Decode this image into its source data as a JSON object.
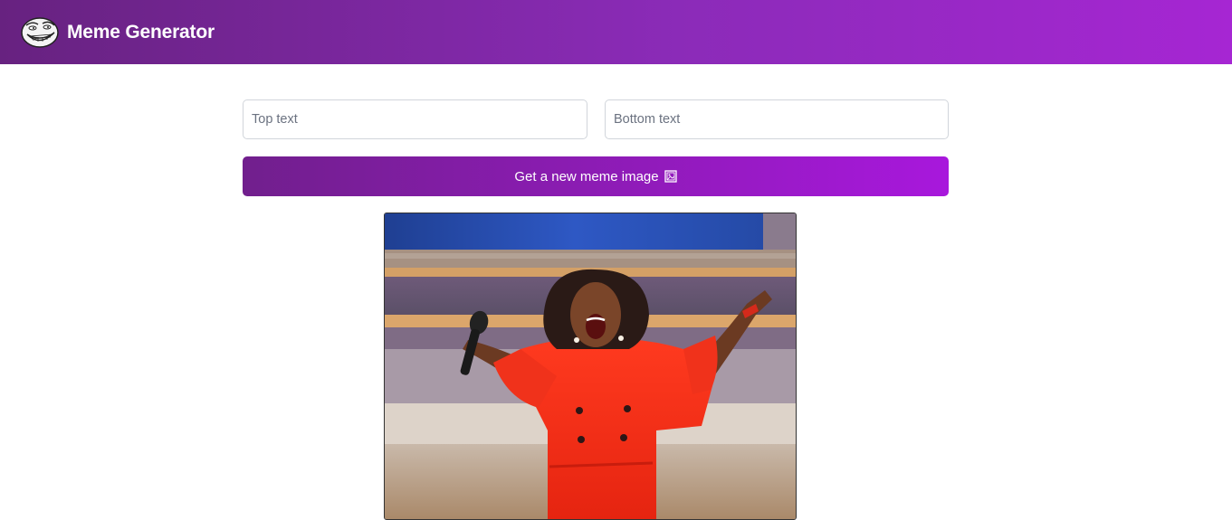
{
  "header": {
    "title": "Meme Generator",
    "logo_icon": "troll-face-icon"
  },
  "form": {
    "top_placeholder": "Top text",
    "bottom_placeholder": "Bottom text",
    "top_value": "",
    "bottom_value": "",
    "submit_label": "Get a new meme image",
    "submit_icon": "framed-picture-icon"
  },
  "meme": {
    "image_subject": "woman in red dress with microphone, arms raised, cheering on stage"
  },
  "colors": {
    "header_gradient_start": "#672280",
    "header_gradient_end": "#a626d3",
    "button_gradient_start": "#711f8d",
    "button_gradient_end": "#a818dc"
  }
}
